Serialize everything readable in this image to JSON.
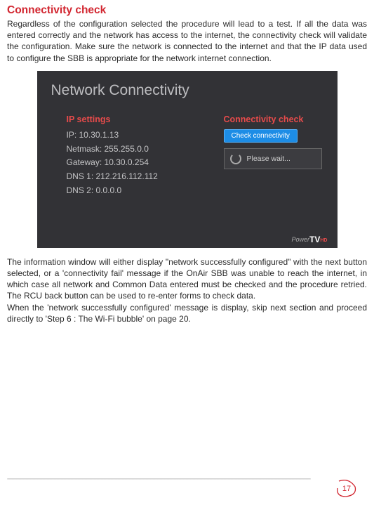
{
  "heading": "Connectivity check",
  "para1": "Regardless of the configuration selected the procedure will lead to a test. If all the data was entered correctly and the network has access to the internet, the connectivity check will validate the configuration. Make sure the network is connected to the internet and that the IP data used to configure the SBB is appropriate for the network internet connection.",
  "screenshot": {
    "title": "Network Connectivity",
    "left_heading": "IP settings",
    "ip": "IP: 10.30.1.13",
    "netmask": "Netmask: 255.255.0.0",
    "gateway": "Gateway: 10.30.0.254",
    "dns1": "DNS 1: 212.216.112.112",
    "dns2": "DNS 2: 0.0.0.0",
    "right_heading": "Connectivity check",
    "button_label": "Check connectivity",
    "message": "Please wait...",
    "logo_power": "Power",
    "logo_tv": "TV",
    "logo_hd": "HD"
  },
  "para2": "The information window will either display \"network successfully configured\" with the next button selected, or a 'connectivity fail' message if the OnAir SBB was unable to reach the internet, in which case all network and Common Data entered must be checked and the procedure retried. The RCU back button can be used to re-enter forms to check data.",
  "para3": "When the 'network successfully configured' message is display, skip next section and proceed directly to 'Step 6 : The Wi-Fi bubble' on page 20.",
  "page_number": "17"
}
